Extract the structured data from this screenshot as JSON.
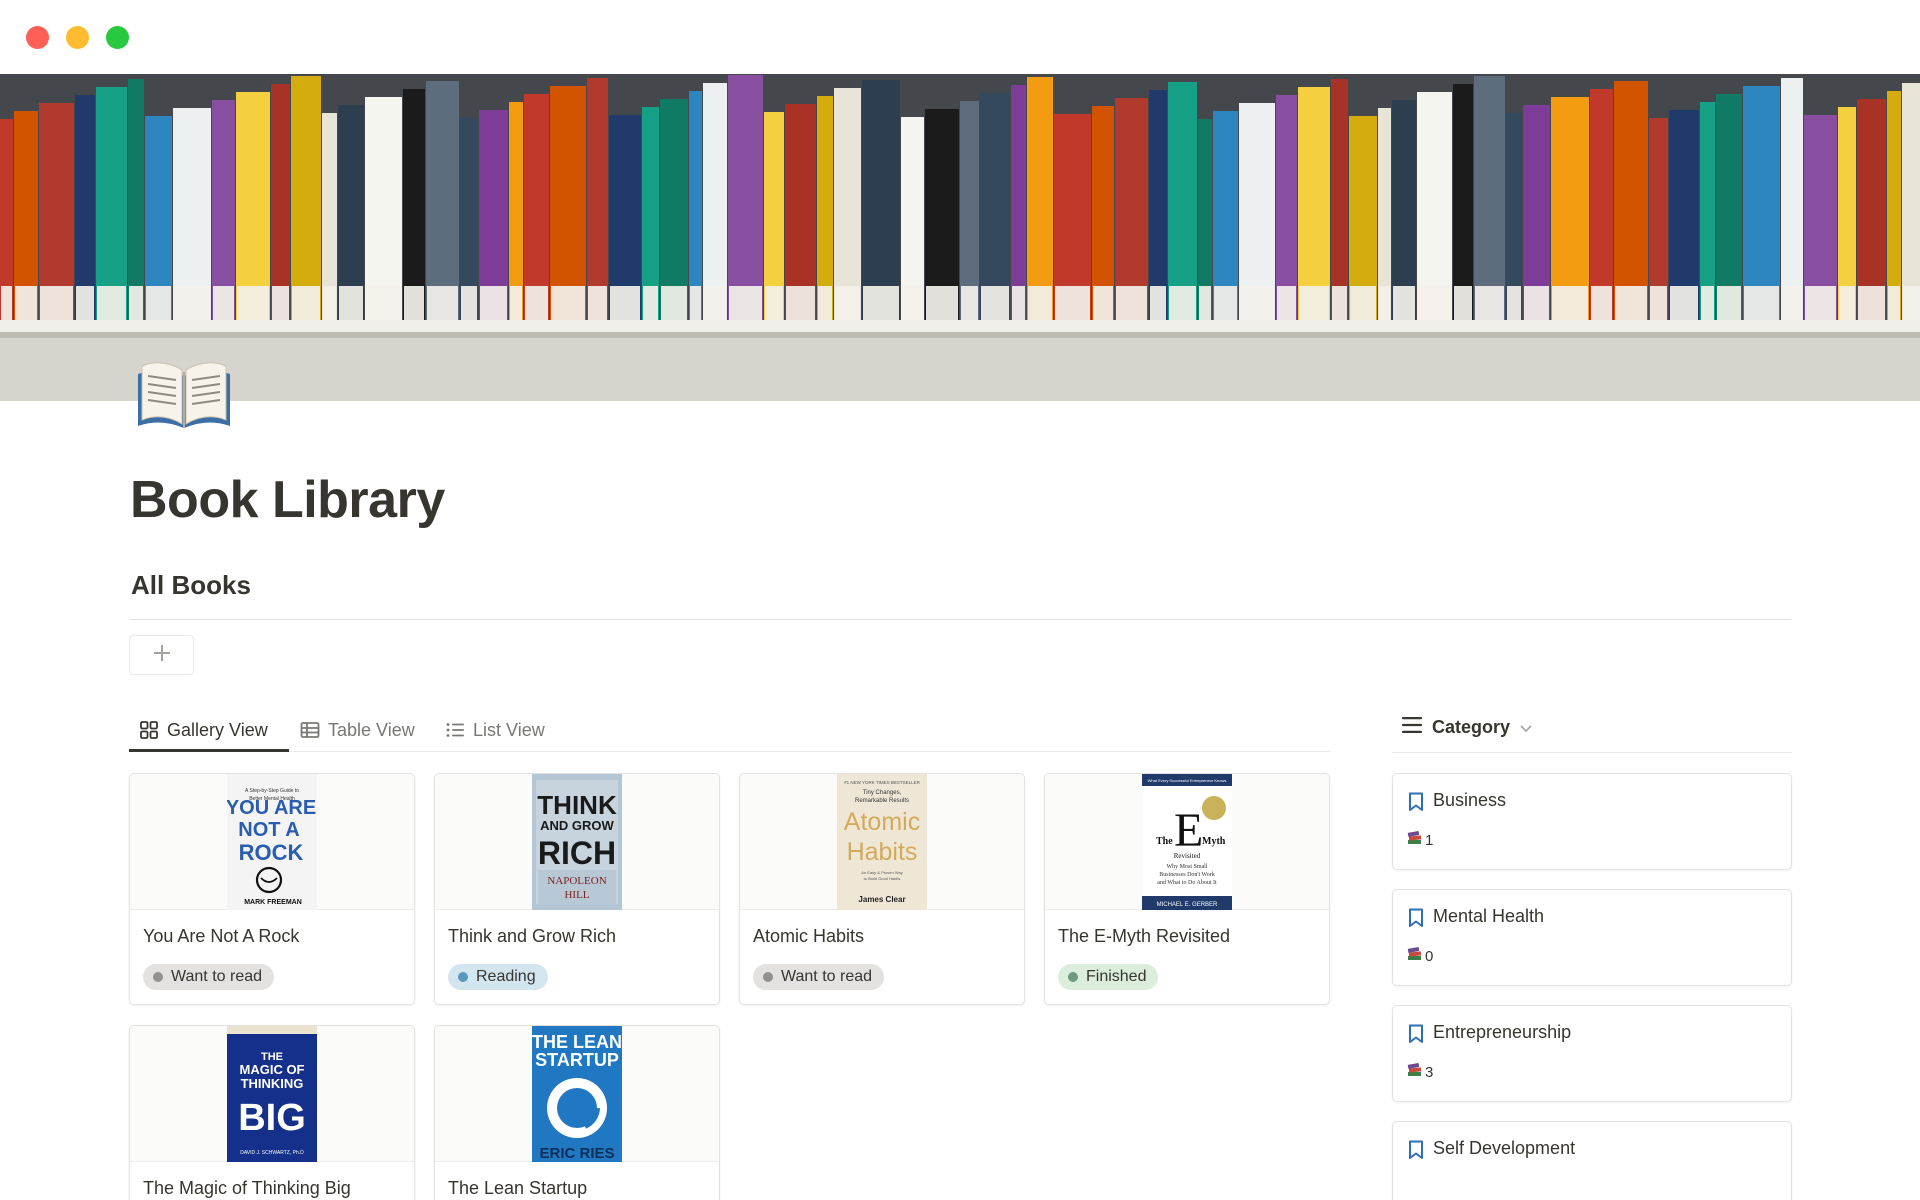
{
  "page": {
    "title": "Book Library",
    "icon": "open-book-icon",
    "section_title": "All Books"
  },
  "views": {
    "tabs": [
      {
        "label": "Gallery View",
        "icon": "gallery-icon",
        "active": true
      },
      {
        "label": "Table View",
        "icon": "table-icon",
        "active": false
      },
      {
        "label": "List View",
        "icon": "list-icon",
        "active": false
      }
    ]
  },
  "books": [
    {
      "title": "You Are Not A Rock",
      "status": "Want to read",
      "cover_text": [
        "YOU ARE",
        "NOT A",
        "ROCK"
      ],
      "cover_author": "MARK FREEMAN"
    },
    {
      "title": "Think and Grow Rich",
      "status": "Reading",
      "cover_text": [
        "THINK",
        "AND GROW",
        "RICH"
      ],
      "cover_author": "NAPOLEON HILL"
    },
    {
      "title": "Atomic Habits",
      "status": "Want to read",
      "cover_text": [
        "Atomic",
        "Habits"
      ],
      "cover_author": "James Clear"
    },
    {
      "title": "The E-Myth Revisited",
      "status": "Finished",
      "cover_text": [
        "The",
        "E",
        "Myth",
        "Revisited"
      ],
      "cover_author": "MICHAEL E. GERBER"
    },
    {
      "title": "The Magic of Thinking Big",
      "status": "",
      "cover_text": [
        "THE",
        "MAGIC OF",
        "THINKING",
        "BIG"
      ],
      "cover_author": "DAVID J. SCHWARTZ, Ph.D"
    },
    {
      "title": "The Lean Startup",
      "status": "",
      "cover_text": [
        "THE LEAN",
        "STARTUP"
      ],
      "cover_author": "ERIC RIES"
    }
  ],
  "status_colors": {
    "Want to read": {
      "bg": "#e3e2e0",
      "dot": "#91918e"
    },
    "Reading": {
      "bg": "#d3e5ef",
      "dot": "#5b97bd"
    },
    "Finished": {
      "bg": "#dbeddb",
      "dot": "#6c9b7d"
    }
  },
  "category": {
    "header_label": "Category",
    "items": [
      {
        "name": "Business",
        "count": "1"
      },
      {
        "name": "Mental Health",
        "count": "0"
      },
      {
        "name": "Entrepreneurship",
        "count": "3"
      },
      {
        "name": "Self Development",
        "count": ""
      }
    ]
  }
}
